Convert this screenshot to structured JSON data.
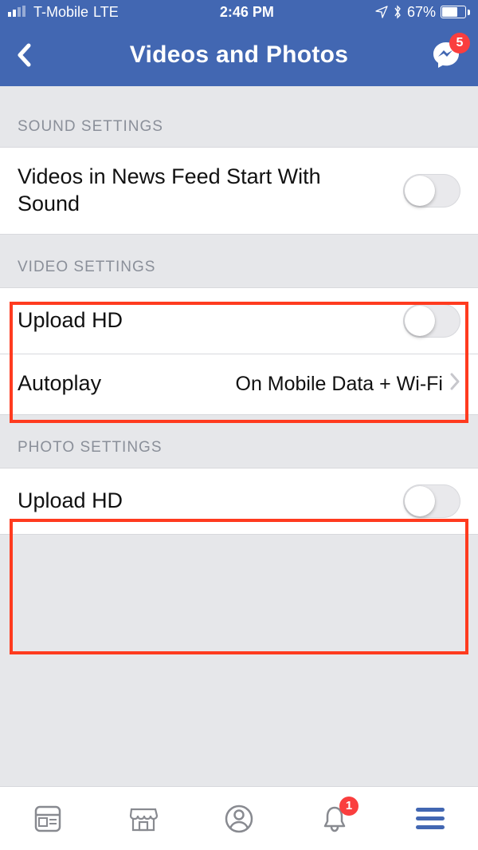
{
  "status": {
    "carrier": "T-Mobile",
    "network": "LTE",
    "time": "2:46 PM",
    "battery_pct": "67%",
    "battery_fill_pct": 67
  },
  "header": {
    "title": "Videos and Photos",
    "messenger_badge": "5"
  },
  "sections": {
    "sound": {
      "title": "SOUND SETTINGS",
      "row_label": "Videos in News Feed Start With Sound"
    },
    "video": {
      "title": "VIDEO SETTINGS",
      "upload_hd_label": "Upload HD",
      "autoplay_label": "Autoplay",
      "autoplay_value": "On Mobile Data + Wi-Fi"
    },
    "photo": {
      "title": "PHOTO SETTINGS",
      "upload_hd_label": "Upload HD"
    }
  },
  "tabbar": {
    "notifications_badge": "1"
  }
}
